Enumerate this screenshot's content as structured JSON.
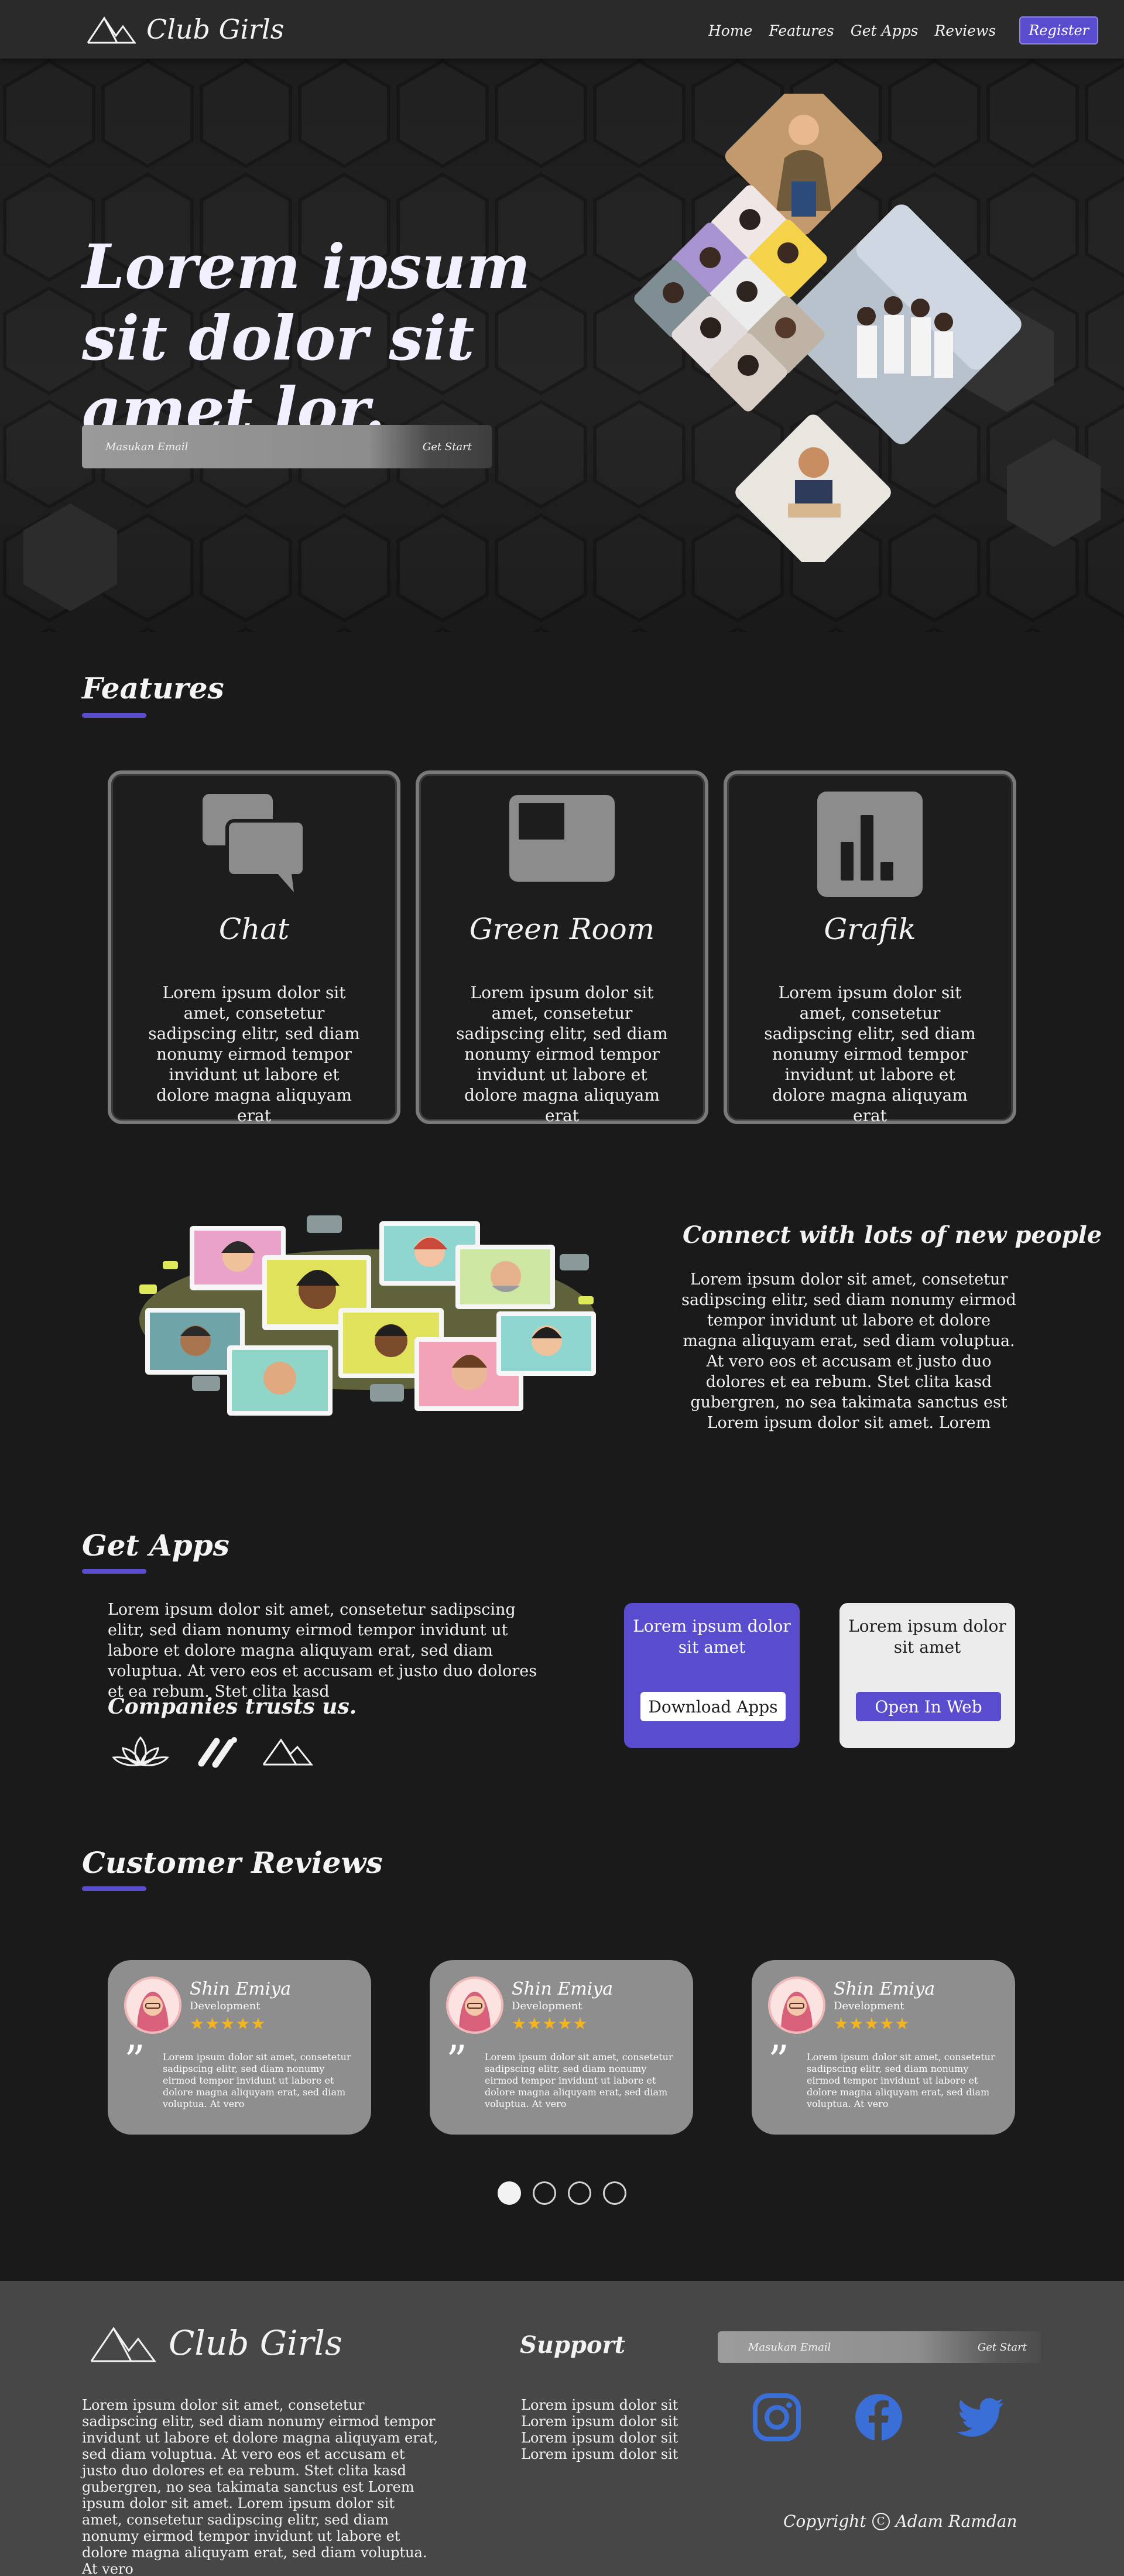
{
  "header": {
    "brand": "Club Girls",
    "nav": [
      "Home",
      "Features",
      "Get Apps",
      "Reviews"
    ],
    "register_label": "Register",
    "accent_color": "#5a4ccf"
  },
  "hero": {
    "title": "Lorem ipsum sit dolor sit amet lor.",
    "email_placeholder": "Masukan Email",
    "cta_label": "Get Start"
  },
  "features": {
    "title": "Features",
    "cards": [
      {
        "name": "Chat",
        "icon": "chat-icon",
        "desc": "Lorem ipsum dolor sit amet, consetetur sadipscing elitr, sed diam nonumy eirmod tempor invidunt ut labore et dolore magna aliquyam erat"
      },
      {
        "name": "Green Room",
        "icon": "video-room-icon",
        "desc": "Lorem ipsum dolor sit amet, consetetur sadipscing elitr, sed diam nonumy eirmod tempor invidunt ut labore et dolore magna aliquyam erat"
      },
      {
        "name": "Grafik",
        "icon": "bar-chart-icon",
        "desc": "Lorem ipsum dolor sit amet, consetetur sadipscing elitr, sed diam nonumy eirmod tempor invidunt ut labore et dolore magna aliquyam erat"
      }
    ]
  },
  "connect": {
    "title": "Connect with lots of new people",
    "desc": "Lorem ipsum dolor sit amet, consetetur sadipscing elitr, sed diam nonumy eirmod tempor invidunt ut labore et dolore magna aliquyam erat, sed diam voluptua. At vero eos et accusam et justo duo dolores et ea rebum. Stet clita kasd gubergren, no sea takimata sanctus est Lorem ipsum dolor sit amet. Lorem"
  },
  "get_apps": {
    "title": "Get Apps",
    "desc": "Lorem ipsum dolor sit amet, consetetur sadipscing elitr, sed diam nonumy eirmod tempor invidunt ut labore et dolore magna aliquyam erat, sed diam voluptua. At vero eos et accusam et justo duo dolores et ea rebum. Stet clita kasd",
    "trust_title": "Companies trusts us.",
    "download_card": {
      "text": "Lorem ipsum dolor sit amet",
      "button": "Download Apps"
    },
    "web_card": {
      "text": "Lorem ipsum dolor sit amet",
      "button": "Open In Web"
    }
  },
  "reviews": {
    "title": "Customer Reviews",
    "items": [
      {
        "name": "Shin Emiya",
        "role": "Development",
        "stars": "★★★★★",
        "rating": 4.5,
        "text": "Lorem ipsum dolor sit amet, consetetur sadipscing elitr, sed diam nonumy eirmod tempor invidunt ut labore et dolore magna aliquyam erat, sed diam voluptua. At vero"
      },
      {
        "name": "Shin Emiya",
        "role": "Development",
        "stars": "★★★★★",
        "rating": 4.5,
        "text": "Lorem ipsum dolor sit amet, consetetur sadipscing elitr, sed diam nonumy eirmod tempor invidunt ut labore et dolore magna aliquyam erat, sed diam voluptua. At vero"
      },
      {
        "name": "Shin Emiya",
        "role": "Development",
        "stars": "★★★★★",
        "rating": 4.5,
        "text": "Lorem ipsum dolor sit amet, consetetur sadipscing elitr, sed diam nonumy eirmod tempor invidunt ut labore et dolore magna aliquyam erat, sed diam voluptua. At vero"
      }
    ],
    "pagination_active": 1,
    "pagination_count": 4
  },
  "footer": {
    "brand": "Club Girls",
    "desc": "Lorem ipsum dolor sit amet, consetetur sadipscing elitr, sed diam nonumy eirmod tempor invidunt ut labore et dolore magna aliquyam erat, sed diam voluptua. At vero eos et accusam et justo duo dolores et ea rebum. Stet clita kasd gubergren, no sea takimata sanctus est Lorem ipsum dolor sit amet. Lorem ipsum dolor sit amet, consetetur sadipscing elitr, sed diam nonumy eirmod tempor invidunt ut labore et dolore magna aliquyam erat, sed diam voluptua. At vero",
    "support_title": "Support",
    "support_links": [
      "Lorem ipsum dolor sit",
      "Lorem ipsum dolor sit",
      "Lorem ipsum dolor sit",
      "Lorem ipsum dolor sit"
    ],
    "email_placeholder": "Masukan Email",
    "cta_label": "Get Start",
    "social_icons": [
      "instagram-icon",
      "facebook-icon",
      "twitter-icon"
    ],
    "copyright_label": "Copyright",
    "copyright_symbol": "C",
    "copyright_owner": "Adam Ramdan",
    "social_color": "#3b6fd8"
  }
}
